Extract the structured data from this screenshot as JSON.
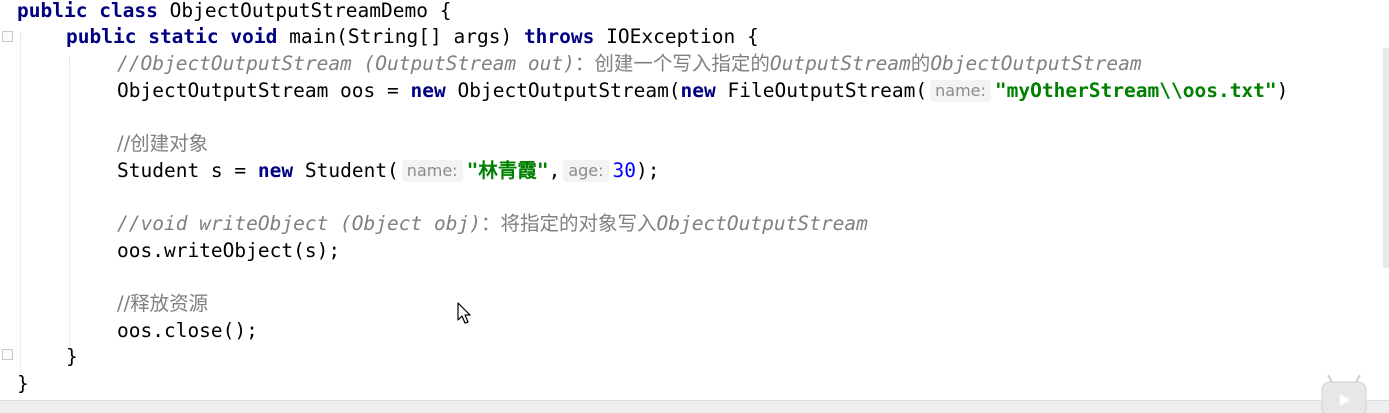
{
  "code": {
    "line1": {
      "kw_public": "public",
      "kw_class": "class",
      "name": "ObjectOutputStreamDemo",
      "brace": "{"
    },
    "line2": {
      "kw_public": "public",
      "kw_static": "static",
      "kw_void": "void",
      "sig": "main(String[] args)",
      "kw_throws": "throws",
      "exc": "IOException",
      "brace": "{"
    },
    "line3": {
      "comment_latin": "//ObjectOutputStream (OutputStream out)",
      "comment_sep": "：",
      "comment_cn1": "创建一个写入指定的",
      "comment_latin2": "OutputStream",
      "comment_cn2": "的",
      "comment_latin3": "ObjectOutputStream"
    },
    "line4": {
      "decl": "ObjectOutputStream oos = ",
      "kw_new": "new",
      "ctor": "ObjectOutputStream(",
      "kw_new2": "new",
      "ctor2": "FileOutputStream(",
      "hint_name": "name:",
      "string": "\"myOtherStream\\\\oos.txt\"",
      "close": ")"
    },
    "line6": {
      "comment": "//创建对象"
    },
    "line7": {
      "decl": "Student s = ",
      "kw_new": "new",
      "ctor": "Student(",
      "hint_name": "name:",
      "string_q1": "\"",
      "string_cn": "林青霞",
      "string_q2": "\"",
      "comma": ",",
      "hint_age": "age:",
      "number": "30",
      "end": ");"
    },
    "line9": {
      "comment_latin": "//void writeObject (Object obj)",
      "comment_sep": "：",
      "comment_cn": "将指定的对象写入",
      "comment_latin2": "ObjectOutputStream"
    },
    "line10": {
      "stmt": "oos.writeObject(s);"
    },
    "line12": {
      "comment": "//释放资源"
    },
    "line13": {
      "stmt": "oos.close();"
    },
    "line14": {
      "brace": "}"
    },
    "line15": {
      "brace": "}"
    }
  },
  "colors": {
    "keyword": "#000080",
    "comment": "#808080",
    "string": "#008000",
    "number": "#0000ff",
    "hint_bg": "#f1f3f4"
  },
  "icons": {
    "cursor": "mouse-pointer-icon",
    "fold_marker": "fold-marker-icon",
    "watermark": "logo-watermark-icon"
  }
}
